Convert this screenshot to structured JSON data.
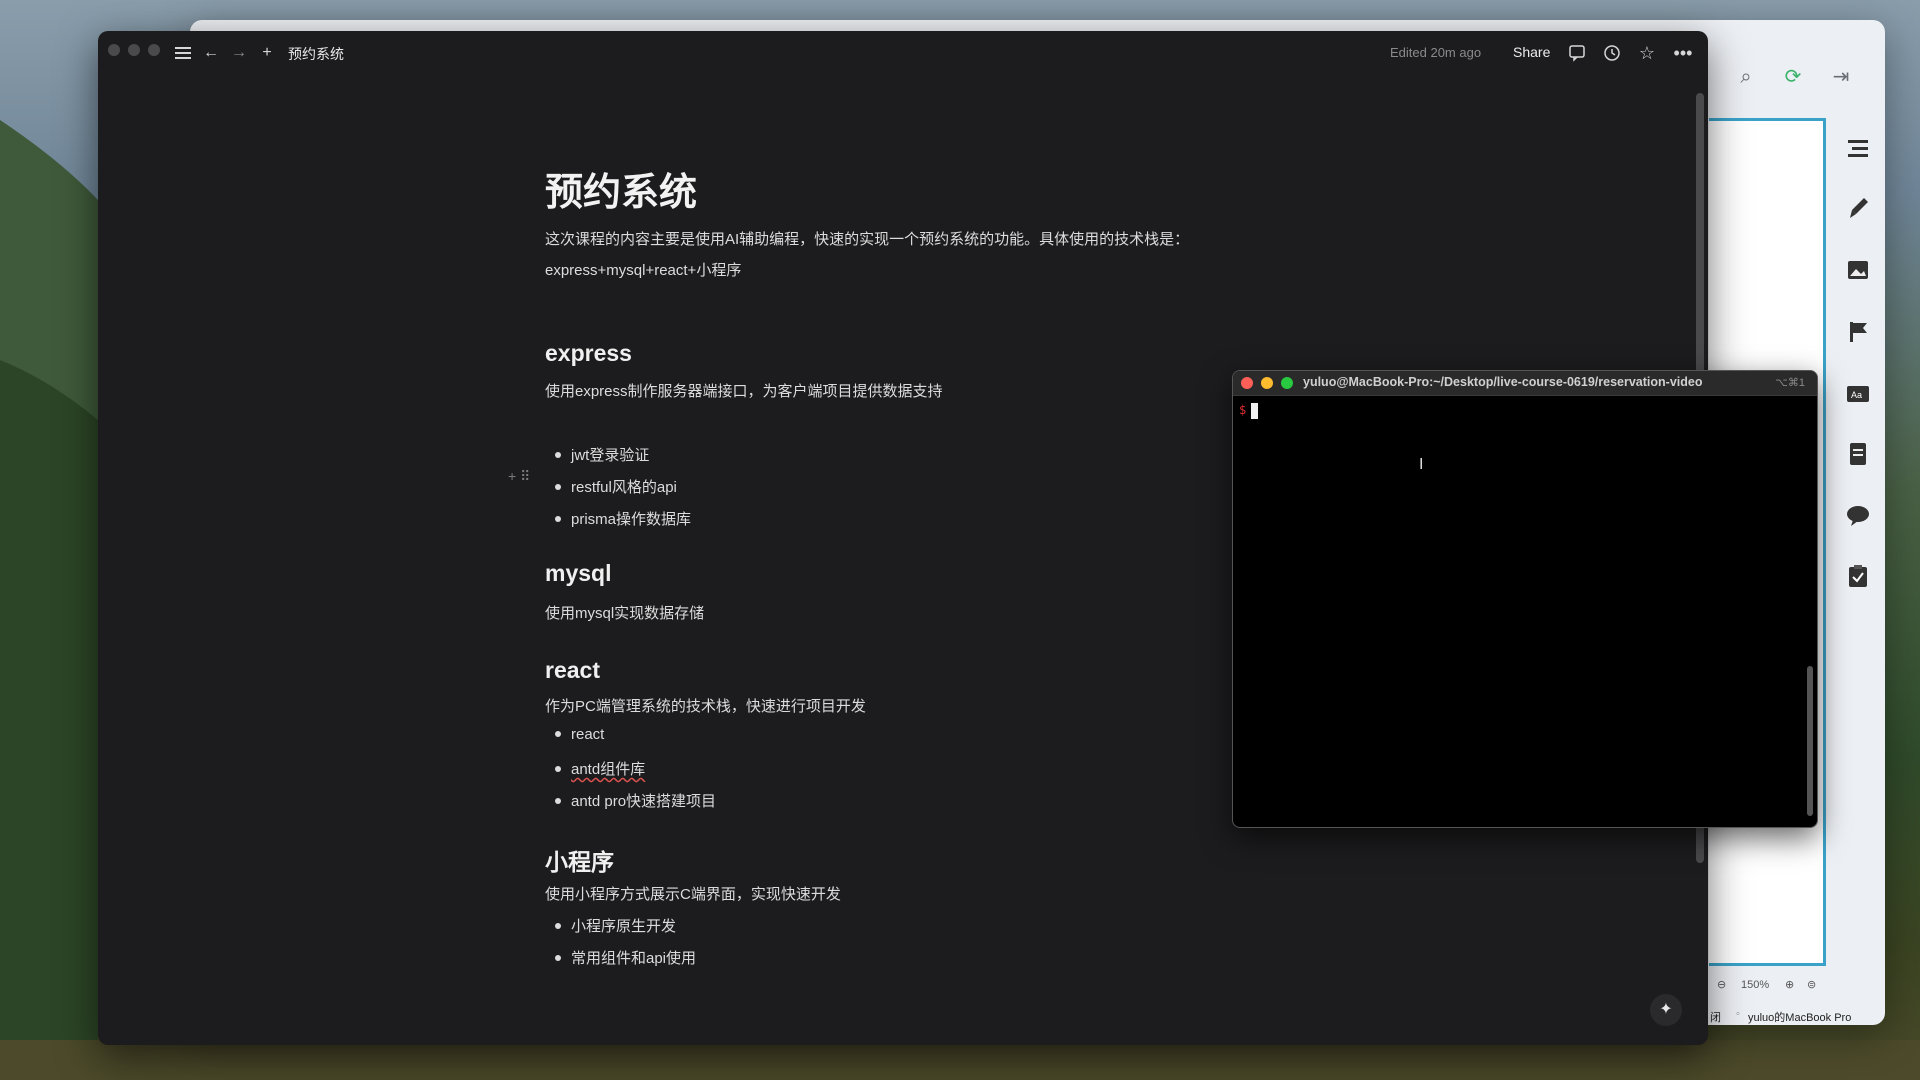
{
  "notes": {
    "breadcrumb": "预约系统",
    "edited": "Edited 20m ago",
    "share_label": "Share",
    "doc": {
      "title": "预约系统",
      "intro_1": "这次课程的内容主要是使用AI辅助编程，快速的实现一个预约系统的功能。具体使用的技术栈是：",
      "intro_2": "express+mysql+react+小程序",
      "sections": [
        {
          "heading": "express",
          "desc": "使用express制作服务器端接口，为客户端项目提供数据支持",
          "items": [
            "jwt登录验证",
            "restful风格的api",
            "prisma操作数据库"
          ]
        },
        {
          "heading": "mysql",
          "desc": "使用mysql实现数据存储",
          "items": []
        },
        {
          "heading": "react",
          "desc": "作为PC端管理系统的技术栈，快速进行项目开发",
          "items": [
            "react",
            "antd组件库",
            "antd pro快速搭建项目"
          ]
        },
        {
          "heading": "小程序",
          "desc": "使用小程序方式展示C端界面，实现快速开发",
          "items": [
            "小程序原生开发",
            "常用组件和api使用"
          ]
        }
      ]
    }
  },
  "terminal": {
    "title": "yuluo@MacBook-Pro:~/Desktop/live-course-0619/reservation-video",
    "shortcut": "⌥⌘1",
    "prompt": "$"
  },
  "background_app": {
    "zoom": "150%",
    "status_left": "闭",
    "status_device": "yuluo的MacBook Pro"
  },
  "icons": [
    "menu-icon",
    "back-arrow-icon",
    "forward-arrow-icon",
    "plus-icon",
    "comment-icon",
    "history-icon",
    "star-icon",
    "more-icon",
    "sparkle-icon"
  ],
  "colors": {
    "accent_blue": "#3aa2c8",
    "term_close": "#ff5f57",
    "term_min": "#febc2e",
    "term_max": "#28c840"
  }
}
